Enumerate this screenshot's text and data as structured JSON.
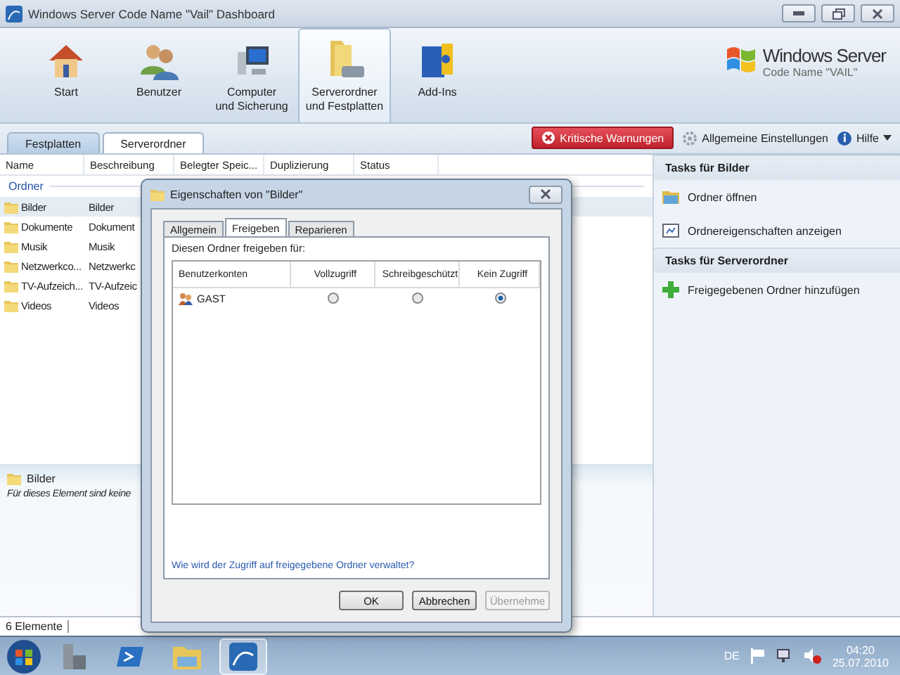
{
  "window": {
    "title": "Windows Server Code Name \"Vail\" Dashboard"
  },
  "nav": [
    {
      "kind": "home",
      "lines": [
        "Start"
      ],
      "selected": false
    },
    {
      "kind": "users",
      "lines": [
        "Benutzer"
      ],
      "selected": false
    },
    {
      "kind": "computer",
      "lines": [
        "Computer",
        "und Sicherung"
      ],
      "selected": false
    },
    {
      "kind": "folders",
      "lines": [
        "Serverordner",
        "und Festplatten"
      ],
      "selected": true
    },
    {
      "kind": "addins",
      "lines": [
        "Add-Ins"
      ],
      "selected": false
    }
  ],
  "logo": {
    "title": "Windows Server",
    "subtitle": "Code Name \"VAIL\""
  },
  "tabs": [
    {
      "label": "Festplatten",
      "selected": false
    },
    {
      "label": "Serverordner",
      "selected": true
    }
  ],
  "toolbar": {
    "alert": "Kritische Warnungen",
    "settings": "Allgemeine Einstellungen",
    "help": "Hilfe"
  },
  "table": {
    "columns": [
      "Name",
      "Beschreibung",
      "Belegter Speic...",
      "Duplizierung",
      "Status"
    ],
    "group": "Ordner",
    "rows": [
      {
        "name": "Bilder",
        "description": "Bilder",
        "selected": true
      },
      {
        "name": "Dokumente",
        "description": "Dokument",
        "selected": false
      },
      {
        "name": "Musik",
        "description": "Musik",
        "selected": false
      },
      {
        "name": "Netzwerkco...",
        "description": "Netzwerkc",
        "selected": false
      },
      {
        "name": "TV-Aufzeich...",
        "description": "TV-Aufzeic",
        "selected": false
      },
      {
        "name": "Videos",
        "description": "Videos",
        "selected": false
      }
    ]
  },
  "details": {
    "title": "Bilder",
    "text": "Für dieses Element sind keine"
  },
  "tasks": [
    {
      "title": "Tasks für Bilder",
      "items": [
        {
          "kind": "open",
          "label": "Ordner öffnen"
        },
        {
          "kind": "properties",
          "label": "Ordnereigenschaften anzeigen"
        }
      ]
    },
    {
      "title": "Tasks für Serverordner",
      "items": [
        {
          "kind": "add",
          "label": "Freigegebenen Ordner hinzufügen"
        }
      ]
    }
  ],
  "status_bar": "6 Elemente",
  "dialog": {
    "title": "Eigenschaften von \"Bilder\"",
    "tabs": [
      {
        "label": "Allgemein",
        "selected": false
      },
      {
        "label": "Freigeben",
        "selected": true
      },
      {
        "label": "Reparieren",
        "selected": false
      }
    ],
    "prompt": "Diesen Ordner freigeben für:",
    "columns": [
      "Benutzerkonten",
      "Vollzugriff",
      "Schreibgeschützt",
      "Kein Zugriff"
    ],
    "rows": [
      {
        "account": "GAST",
        "access": [
          {
            "selected": false
          },
          {
            "selected": false
          },
          {
            "selected": true
          }
        ]
      }
    ],
    "link": "Wie wird der Zugriff auf freigegebene Ordner verwaltet?",
    "buttons": [
      {
        "label": "OK",
        "disabled": false
      },
      {
        "label": "Abbrechen",
        "disabled": false
      },
      {
        "label": "Übernehme",
        "disabled": true
      }
    ]
  },
  "taskbar": {
    "apps": [
      {
        "kind": "server",
        "selected": false
      },
      {
        "kind": "shell",
        "selected": false
      },
      {
        "kind": "explorer",
        "selected": false
      },
      {
        "kind": "dashboard",
        "selected": true
      }
    ],
    "language": "DE",
    "time": "04:20",
    "date": "25.07.2010"
  }
}
